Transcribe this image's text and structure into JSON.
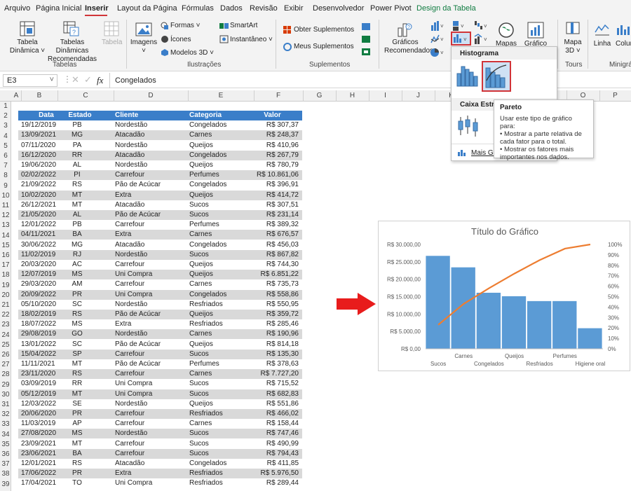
{
  "tabs": [
    "Arquivo",
    "Página Inicial",
    "Inserir",
    "Layout da Página",
    "Fórmulas",
    "Dados",
    "Revisão",
    "Exibir",
    "Desenvolvedor",
    "Power Pivot",
    "Design da Tabela"
  ],
  "ribbon": {
    "pivot_table": "Tabela\nDinâmica ˅",
    "rec_pivot": "Tabelas Dinâmicas\nRecomendadas",
    "table": "Tabela",
    "group_tables": "Tabelas",
    "images": "Imagens\n˅",
    "shapes": "Formas ˅",
    "icons": "Ícones",
    "models3d": "Modelos 3D ˅",
    "smartart": "SmartArt",
    "snapshot": "Instantâneo ˅",
    "group_illustrations": "Ilustrações",
    "get_addins": "Obter Suplementos",
    "my_addins": "Meus Suplementos",
    "group_addins": "Suplementos",
    "rec_charts": "Gráficos\nRecomendados",
    "maps": "Mapas",
    "pivot_chart": "Gráfico",
    "map3d": "Mapa\n3D ˅",
    "group_tours": "Tours",
    "line": "Linha",
    "column": "Colun",
    "group_mini": "Minigrá"
  },
  "dropdown": {
    "histogram_title": "Histograma",
    "boxwhisker_title": "Caixa Estreit",
    "more": "Mais Gr"
  },
  "tooltip": {
    "title": "Pareto",
    "body": "Usar este tipo de gráfico para:\n• Mostrar a parte relativa de\ncada fator para o total.\n• Mostrar os fatores mais\nimportantes nos dados."
  },
  "formula_bar": {
    "cell": "E3",
    "value": "Congelados",
    "fx": "fx"
  },
  "columns": [
    "A",
    "B",
    "C",
    "D",
    "E",
    "F",
    "G",
    "H",
    "I",
    "J",
    "K",
    "L",
    "M",
    "N",
    "O",
    "P"
  ],
  "table": {
    "headers": [
      "Data",
      "Estado",
      "Cliente",
      "Categoria",
      "Valor"
    ],
    "rows": [
      [
        "19/12/2019",
        "PB",
        "Nordestão",
        "Congelados",
        "R$ 307,37"
      ],
      [
        "13/09/2021",
        "MG",
        "Atacadão",
        "Carnes",
        "R$ 248,37"
      ],
      [
        "07/11/2020",
        "PA",
        "Nordestão",
        "Queijos",
        "R$ 410,96"
      ],
      [
        "16/12/2020",
        "RR",
        "Atacadão",
        "Congelados",
        "R$ 267,79"
      ],
      [
        "19/06/2020",
        "AL",
        "Nordestão",
        "Queijos",
        "R$ 780,79"
      ],
      [
        "02/02/2022",
        "PI",
        "Carrefour",
        "Perfumes",
        "R$ 10.861,06"
      ],
      [
        "21/09/2022",
        "RS",
        "Pão de Acúcar",
        "Congelados",
        "R$ 396,91"
      ],
      [
        "10/02/2020",
        "MT",
        "Extra",
        "Queijos",
        "R$ 414,72"
      ],
      [
        "26/12/2021",
        "MT",
        "Atacadão",
        "Sucos",
        "R$ 307,51"
      ],
      [
        "21/05/2020",
        "AL",
        "Pão de Acúcar",
        "Sucos",
        "R$ 231,14"
      ],
      [
        "12/01/2022",
        "PB",
        "Carrefour",
        "Perfumes",
        "R$ 389,32"
      ],
      [
        "04/11/2021",
        "BA",
        "Extra",
        "Carnes",
        "R$ 676,57"
      ],
      [
        "30/06/2022",
        "MG",
        "Atacadão",
        "Congelados",
        "R$ 456,03"
      ],
      [
        "11/02/2019",
        "RJ",
        "Nordestão",
        "Sucos",
        "R$ 867,82"
      ],
      [
        "20/03/2020",
        "AC",
        "Carrefour",
        "Queijos",
        "R$ 744,30"
      ],
      [
        "12/07/2019",
        "MS",
        "Uni Compra",
        "Queijos",
        "R$ 6.851,22"
      ],
      [
        "29/03/2020",
        "AM",
        "Carrefour",
        "Carnes",
        "R$ 735,73"
      ],
      [
        "20/09/2022",
        "PR",
        "Uni Compra",
        "Congelados",
        "R$ 558,86"
      ],
      [
        "05/10/2020",
        "SC",
        "Nordestão",
        "Resfriados",
        "R$ 550,95"
      ],
      [
        "18/02/2019",
        "RS",
        "Pão de Acúcar",
        "Queijos",
        "R$ 359,72"
      ],
      [
        "18/07/2022",
        "MS",
        "Extra",
        "Resfriados",
        "R$ 285,46"
      ],
      [
        "29/08/2019",
        "GO",
        "Nordestão",
        "Carnes",
        "R$ 190,96"
      ],
      [
        "13/01/2022",
        "SC",
        "Pão de Acúcar",
        "Queijos",
        "R$ 814,18"
      ],
      [
        "15/04/2022",
        "SP",
        "Carrefour",
        "Sucos",
        "R$ 135,30"
      ],
      [
        "11/11/2021",
        "MT",
        "Pão de Acúcar",
        "Perfumes",
        "R$ 378,63"
      ],
      [
        "23/11/2020",
        "RS",
        "Carrefour",
        "Carnes",
        "R$ 7.727,20"
      ],
      [
        "03/09/2019",
        "RR",
        "Uni Compra",
        "Sucos",
        "R$ 715,52"
      ],
      [
        "05/12/2019",
        "MT",
        "Uni Compra",
        "Sucos",
        "R$ 682,83"
      ],
      [
        "12/03/2022",
        "SE",
        "Nordestão",
        "Queijos",
        "R$ 551,86"
      ],
      [
        "20/06/2020",
        "PR",
        "Carrefour",
        "Resfriados",
        "R$ 466,02"
      ],
      [
        "11/03/2019",
        "AP",
        "Carrefour",
        "Carnes",
        "R$ 158,44"
      ],
      [
        "27/08/2020",
        "MS",
        "Nordestão",
        "Sucos",
        "R$ 747,46"
      ],
      [
        "23/09/2021",
        "MT",
        "Carrefour",
        "Sucos",
        "R$ 490,99"
      ],
      [
        "23/06/2021",
        "BA",
        "Carrefour",
        "Sucos",
        "R$ 794,43"
      ],
      [
        "12/01/2021",
        "RS",
        "Atacadão",
        "Congelados",
        "R$ 411,85"
      ],
      [
        "17/06/2022",
        "PR",
        "Extra",
        "Resfriados",
        "R$ 5.976,50"
      ],
      [
        "17/04/2021",
        "TO",
        "Uni Compra",
        "Resfriados",
        "R$ 289,44"
      ]
    ]
  },
  "chart_data": {
    "type": "bar",
    "title": "Título do Gráfico",
    "categories": [
      "Sucos",
      "Carnes",
      "Congelados",
      "Queijos",
      "Resfriados",
      "Perfumes",
      "Higiene oral"
    ],
    "values": [
      26800,
      23500,
      16200,
      15200,
      13800,
      13800,
      6000
    ],
    "line_series": {
      "values": [
        23,
        43,
        58,
        72,
        85,
        96,
        100
      ]
    },
    "ylim": [
      0,
      30000
    ],
    "yticks": [
      "R$ 0,00",
      "R$ 5.000,00",
      "R$ 10.000,00",
      "R$ 15.000,00",
      "R$ 20.000,00",
      "R$ 25.000,00",
      "R$ 30.000,00"
    ],
    "y2ticks": [
      "0%",
      "10%",
      "20%",
      "30%",
      "40%",
      "50%",
      "60%",
      "70%",
      "80%",
      "90%",
      "100%"
    ],
    "bar_color": "#5b9bd5",
    "line_color": "#ed7d31"
  }
}
